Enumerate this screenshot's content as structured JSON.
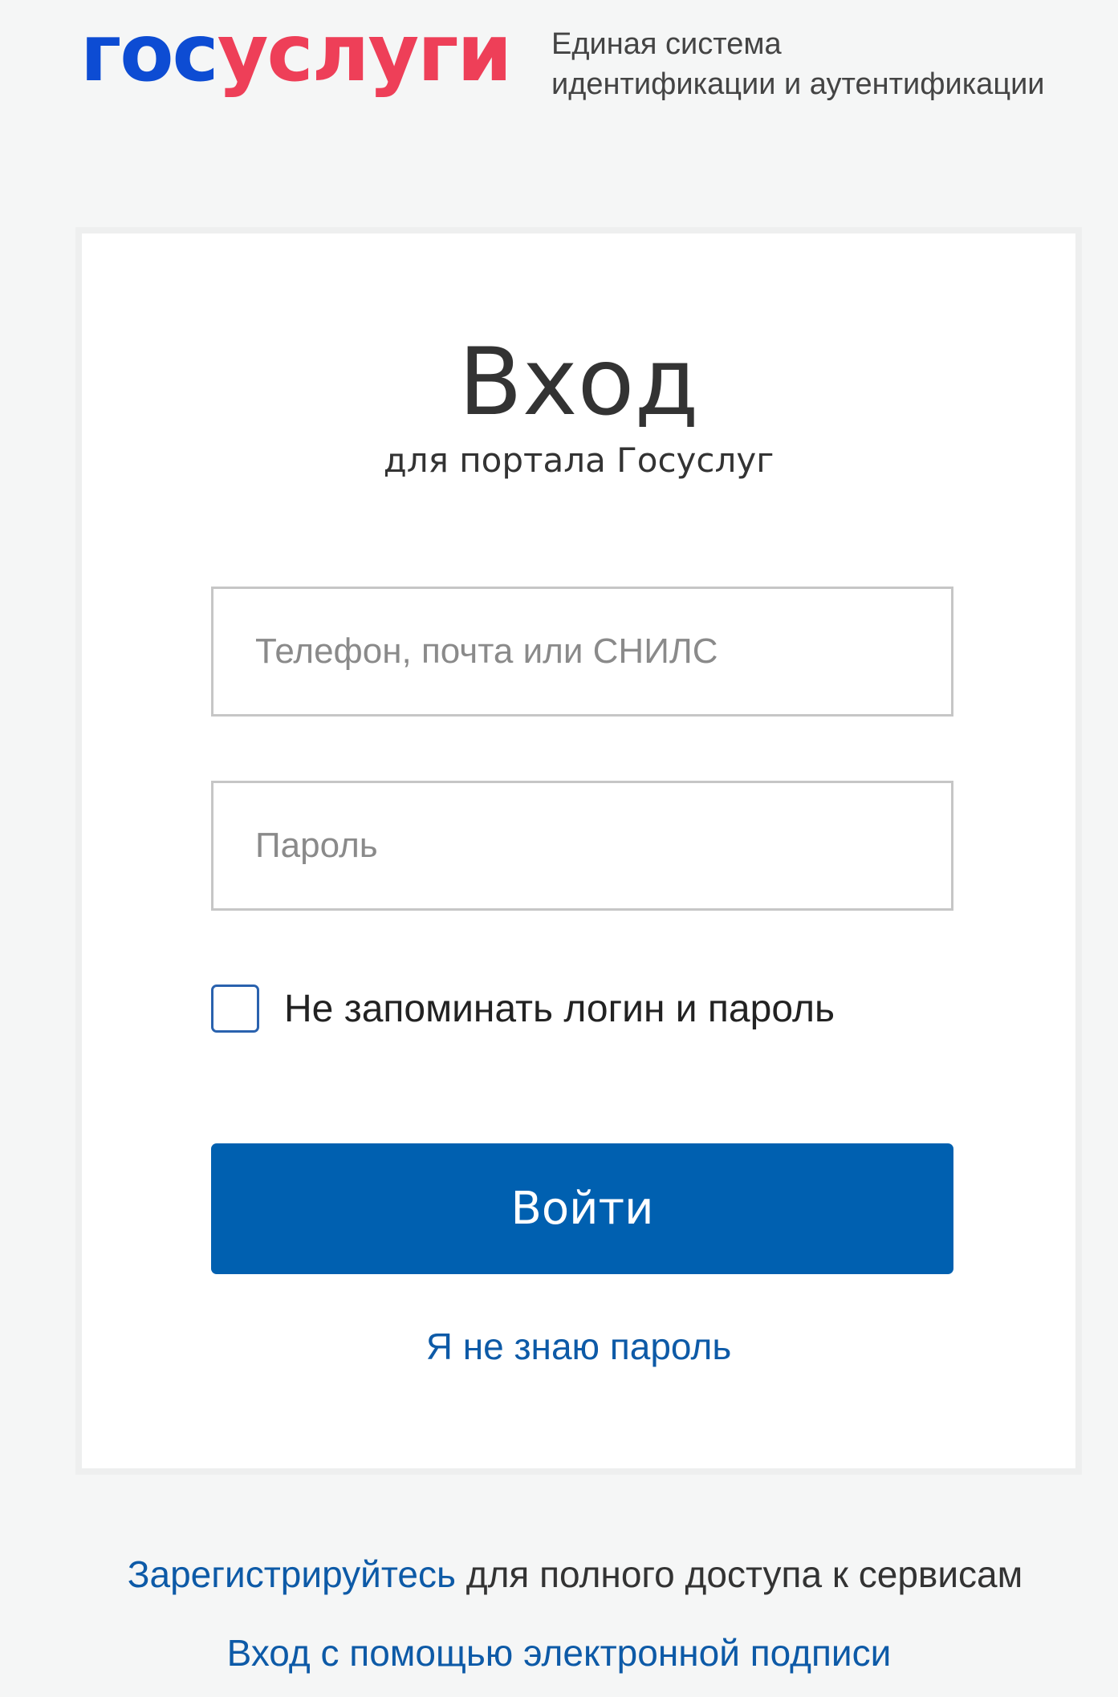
{
  "header": {
    "logo_part_blue": "гос",
    "logo_part_red": "услуги",
    "tagline_line1": "Единая система",
    "tagline_line2": "идентификации и аутентификации"
  },
  "login_card": {
    "title": "Вход",
    "subtitle": "для портала Госуслуг",
    "login_placeholder": "Телефон, почта или СНИЛС",
    "password_placeholder": "Пароль",
    "remember_label": "Не запоминать логин и пароль",
    "remember_checked": false,
    "submit_label": "Войти",
    "forgot_link": "Я не знаю пароль"
  },
  "footer": {
    "register_link": "Зарегистрируйтесь",
    "register_text": " для полного доступа к сервисам",
    "esign_link": "Вход с помощью электронной подписи"
  },
  "colors": {
    "brand_blue": "#0d4cd3",
    "brand_red": "#ee3f58",
    "button_blue": "#0060b0",
    "link_blue": "#0d5aa7"
  }
}
